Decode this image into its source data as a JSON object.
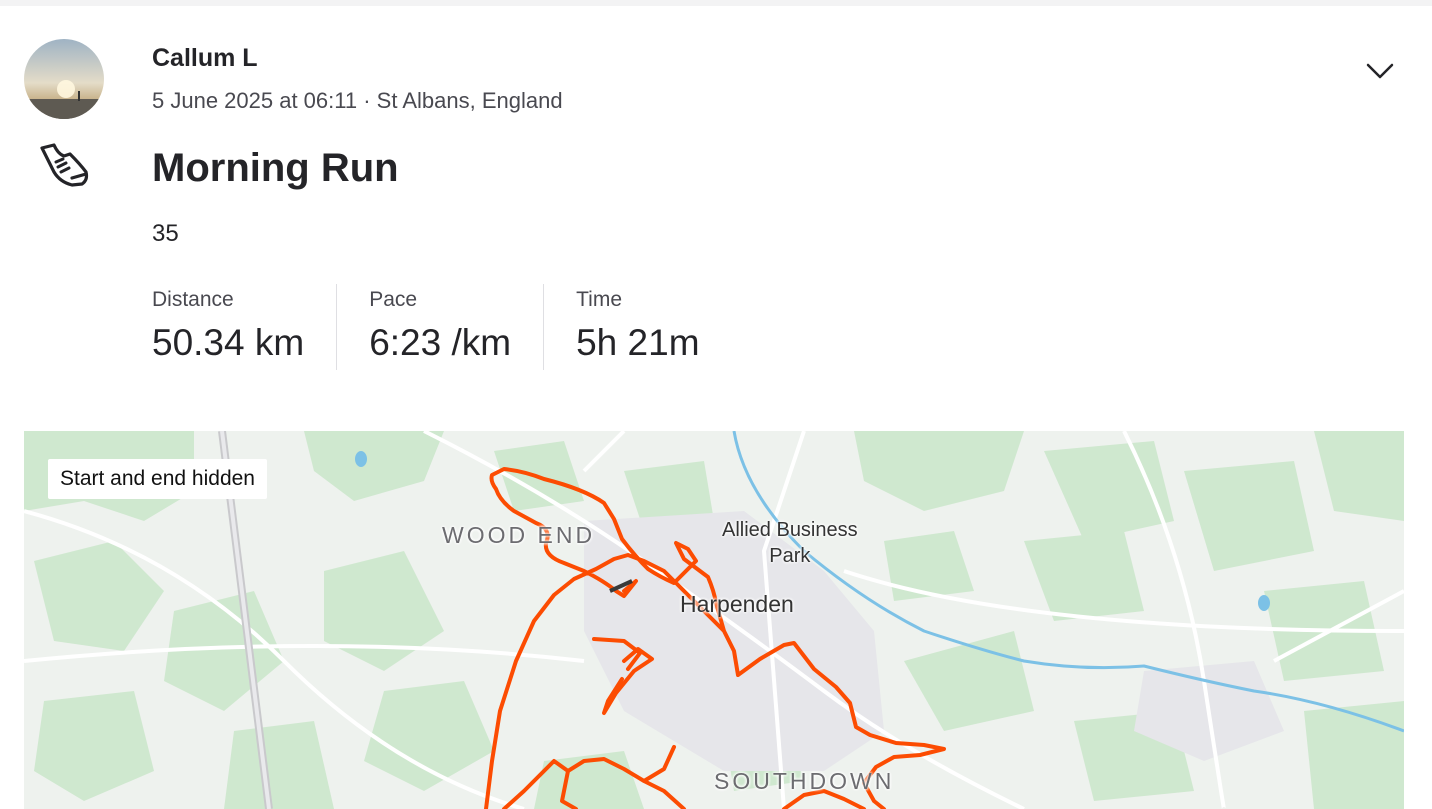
{
  "athlete": {
    "name": "Callum L",
    "date_time": "5 June 2025 at 06:11",
    "separator": " · ",
    "location": "St Albans, England"
  },
  "activity": {
    "type_icon": "running-shoe-icon",
    "title": "Morning Run",
    "description": "35"
  },
  "stats": [
    {
      "label": "Distance",
      "value": "50.34 km"
    },
    {
      "label": "Pace",
      "value": "6:23 /km"
    },
    {
      "label": "Time",
      "value": "5h 21m"
    }
  ],
  "menu": {
    "icon": "chevron-down-icon"
  },
  "map": {
    "privacy_badge": "Start and end hidden",
    "places": {
      "wood_end": "WOOD END",
      "allied_line1": "Allied Business",
      "allied_line2": "Park",
      "harpenden": "Harpenden",
      "southdown": "SOUTHDOWN"
    },
    "colors": {
      "route": "#fc4c02",
      "land": "#eef2ee",
      "green": "#cfe8cf",
      "water": "#7cc1e6"
    }
  }
}
